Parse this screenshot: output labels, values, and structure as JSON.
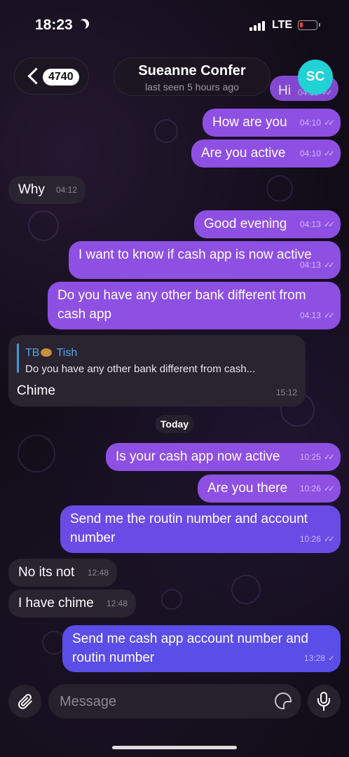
{
  "status": {
    "time": "18:23",
    "network": "LTE"
  },
  "header": {
    "unread_count": "4740",
    "contact_name": "Sueanne Confer",
    "last_seen": "last seen 5 hours ago",
    "avatar_initials": "SC",
    "avatar_color": "#22d1d4"
  },
  "messages": [
    {
      "dir": "out",
      "text": "Hi",
      "time": "04:10",
      "status": "read"
    },
    {
      "dir": "out",
      "text": "How are you",
      "time": "04:10",
      "status": "read"
    },
    {
      "dir": "out",
      "text": "Are you active",
      "time": "04:10",
      "status": "read"
    },
    {
      "dir": "in",
      "text": "Why",
      "time": "04:12"
    },
    {
      "dir": "out",
      "text": "Good evening",
      "time": "04:13",
      "status": "read"
    },
    {
      "dir": "out",
      "text": "I want to know if cash app is now active",
      "time": "04:13",
      "status": "read"
    },
    {
      "dir": "out",
      "text": "Do you have any other bank different from cash app",
      "line1": "Do you have any other bank different from",
      "line2": "cash app",
      "time": "04:13",
      "status": "read"
    },
    {
      "dir": "in",
      "reply_to": {
        "name_prefix": "TB",
        "name": "Tish",
        "text": "Do you have any other bank different from cash..."
      },
      "text": "Chime",
      "time": "15:12"
    },
    {
      "dir": "out",
      "text": "Is your cash app now active",
      "time": "10:25",
      "status": "read"
    },
    {
      "dir": "out",
      "text": "Are you there",
      "time": "10:26",
      "status": "read"
    },
    {
      "dir": "out",
      "text": "Send me the routin number and account number",
      "line1": "Send me the routin number and account",
      "line2": "number",
      "time": "10:26",
      "status": "read"
    },
    {
      "dir": "in",
      "text": "No its not",
      "time": "12:48"
    },
    {
      "dir": "in",
      "text": "I have chime",
      "time": "12:48"
    },
    {
      "dir": "out",
      "text": "Send me cash app account number and routin number",
      "line1": "Send me cash app account number and",
      "line2": "routin number",
      "time": "13:28",
      "status": "delivered"
    }
  ],
  "date_separator": "Today",
  "composer": {
    "placeholder": "Message"
  },
  "colors": {
    "outgoing": "#8e4fe3",
    "incoming": "#2a2330",
    "accent": "#51a6ea"
  },
  "icons": [
    "back-chevron-icon",
    "paperclip-icon",
    "sticker-icon",
    "microphone-icon"
  ]
}
